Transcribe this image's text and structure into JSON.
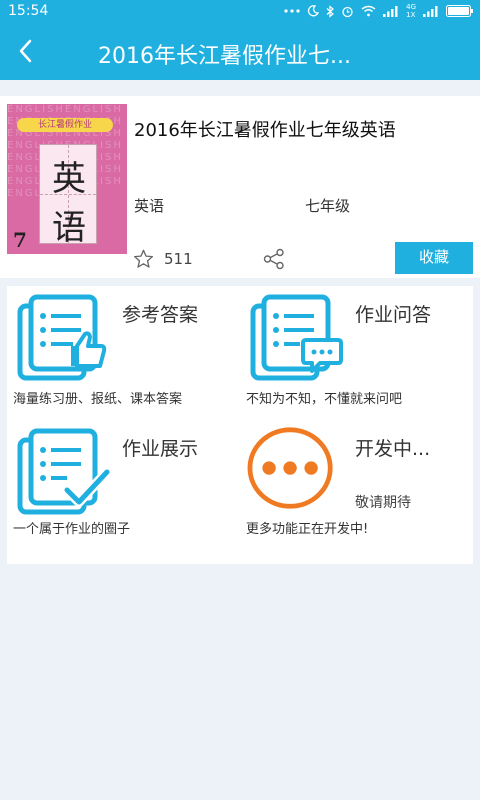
{
  "status_bar": {
    "time": "15:54",
    "network": "4G",
    "network_sub": "1X"
  },
  "header": {
    "title": "2016年长江暑假作业七..."
  },
  "book": {
    "title": "2016年长江暑假作业七年级英语",
    "subject": "英语",
    "grade": "七年级",
    "star_count": "511",
    "favorite_label": "收藏",
    "cover": {
      "top_label": "长江暑假作业",
      "char1": "英",
      "char2": "语",
      "number": "7"
    }
  },
  "features": [
    {
      "name": "参考答案",
      "desc": "海量练习册、报纸、课本答案"
    },
    {
      "name": "作业问答",
      "desc": "不知为不知，不懂就来问吧"
    },
    {
      "name": "作业展示",
      "desc": "一个属于作业的圈子"
    },
    {
      "name": "开发中...",
      "subtitle": "敬请期待",
      "desc": "更多功能正在开发中!"
    }
  ],
  "colors": {
    "accent": "#1fb0e0",
    "orange": "#f07a22",
    "background": "#edf1f8"
  }
}
